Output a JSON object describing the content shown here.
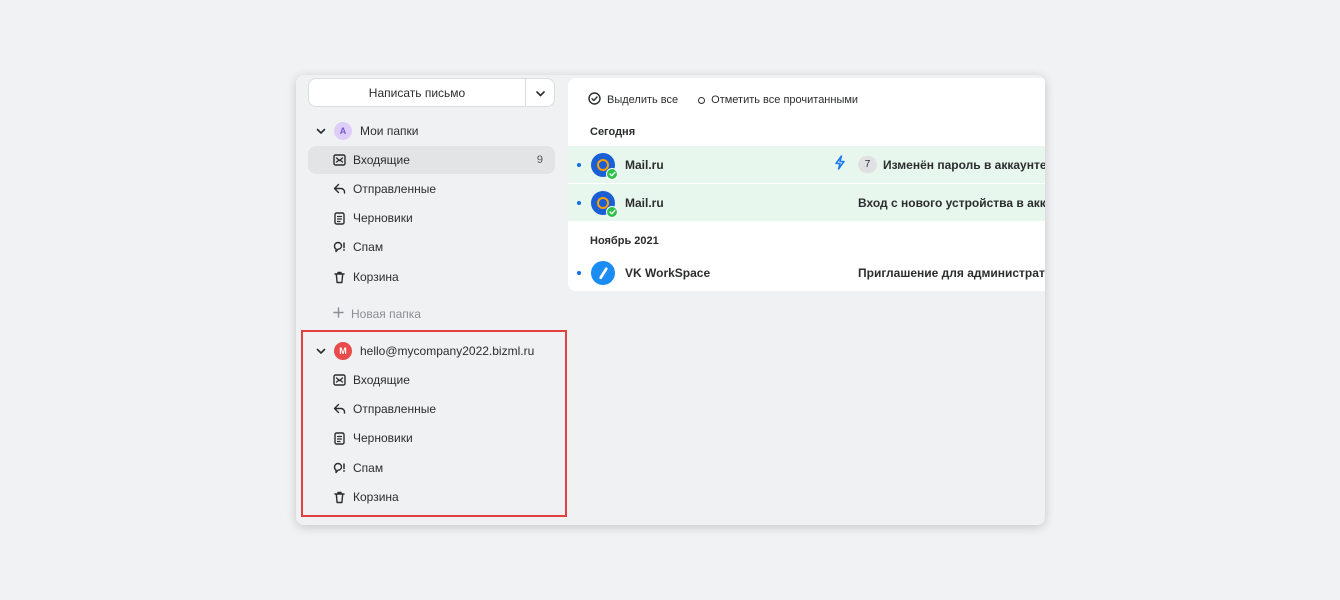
{
  "compose": {
    "label": "Написать письмо"
  },
  "my_folders": {
    "title": "Мои папки",
    "avatar_letter": "A",
    "avatar_color": "#d7c6f7",
    "folders": [
      {
        "label": "Входящие",
        "count": "9",
        "icon": "inbox-icon"
      },
      {
        "label": "Отправленные",
        "icon": "sent-icon"
      },
      {
        "label": "Черновики",
        "icon": "drafts-icon"
      },
      {
        "label": "Спам",
        "icon": "spam-icon"
      },
      {
        "label": "Корзина",
        "icon": "trash-icon"
      }
    ],
    "new_folder": "Новая папка"
  },
  "account": {
    "title": "hello@mycompany2022.bizml.ru",
    "avatar_letter": "M",
    "avatar_color": "#e94b4b",
    "folders": [
      {
        "label": "Входящие",
        "icon": "inbox-icon"
      },
      {
        "label": "Отправленные",
        "icon": "sent-icon"
      },
      {
        "label": "Черновики",
        "icon": "drafts-icon"
      },
      {
        "label": "Спам",
        "icon": "spam-icon"
      },
      {
        "label": "Корзина",
        "icon": "trash-icon"
      }
    ]
  },
  "toolbar": {
    "select_all": "Выделить все",
    "mark_all_read": "Отметить все прочитанными"
  },
  "sections": {
    "today": "Сегодня",
    "november": "Ноябрь 2021"
  },
  "messages": [
    {
      "sender": "Mail.ru",
      "subject": "Изменён пароль в аккаунте",
      "thread_count": "7",
      "flag": "lightning-icon"
    },
    {
      "sender": "Mail.ru",
      "subject": "Вход с нового устройства в аккаунт"
    },
    {
      "sender": "VK WorkSpace",
      "subject": "Приглашение для администратора"
    }
  ],
  "colors": {
    "accent": "#0a6ee0",
    "highlight": "#e0403e",
    "unread_row": "#e8f7ee"
  }
}
